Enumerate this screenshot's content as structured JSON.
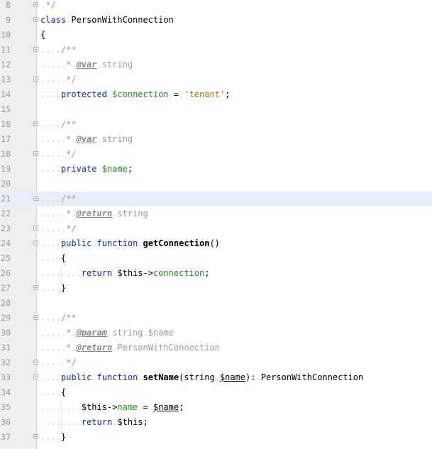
{
  "colors": {
    "keyword": "#0b2bb3",
    "variable": "#238a23",
    "string": "#b8711a",
    "comment": "#9a9a9a",
    "doc_tag": "#888888",
    "whitespace_marker": "#d0d0d0",
    "current_line_bg": "#e8eef8",
    "gutter_bg": "#efefef"
  },
  "editor": {
    "current_line": 21,
    "lines": [
      {
        "n": "8",
        "fold": true,
        "t": [
          [
            "ws",
            "."
          ],
          [
            "cmt",
            "*/"
          ]
        ]
      },
      {
        "n": "9",
        "fold": true,
        "t": [
          [
            "kw",
            "class"
          ],
          [
            "ws",
            "."
          ],
          [
            "pl",
            "PersonWithConnection"
          ]
        ]
      },
      {
        "n": "10",
        "fold": false,
        "t": [
          [
            "pl",
            "{"
          ]
        ]
      },
      {
        "n": "11",
        "fold": true,
        "t": [
          [
            "ws",
            "...."
          ],
          [
            "cmt",
            "/**"
          ]
        ]
      },
      {
        "n": "12",
        "fold": false,
        "t": [
          [
            "ws",
            "....."
          ],
          [
            "cmt",
            "*"
          ],
          [
            "ws",
            "."
          ],
          [
            "tag",
            "@var"
          ],
          [
            "ws",
            "."
          ],
          [
            "cmt",
            "string"
          ]
        ]
      },
      {
        "n": "13",
        "fold": true,
        "t": [
          [
            "ws",
            "....."
          ],
          [
            "cmt",
            "*/"
          ]
        ]
      },
      {
        "n": "14",
        "fold": false,
        "t": [
          [
            "ws",
            "...."
          ],
          [
            "kw",
            "protected"
          ],
          [
            "ws",
            "."
          ],
          [
            "var",
            "$connection"
          ],
          [
            "ws",
            "."
          ],
          [
            "pl",
            "="
          ],
          [
            "ws",
            "."
          ],
          [
            "str",
            "'tenant'"
          ],
          [
            "pl",
            ";"
          ]
        ]
      },
      {
        "n": "15",
        "fold": false,
        "t": []
      },
      {
        "n": "16",
        "fold": true,
        "t": [
          [
            "ws",
            "...."
          ],
          [
            "cmt",
            "/**"
          ]
        ]
      },
      {
        "n": "17",
        "fold": false,
        "t": [
          [
            "ws",
            "....."
          ],
          [
            "cmt",
            "*"
          ],
          [
            "ws",
            "."
          ],
          [
            "tag",
            "@var"
          ],
          [
            "ws",
            "."
          ],
          [
            "cmt",
            "string"
          ]
        ]
      },
      {
        "n": "18",
        "fold": true,
        "t": [
          [
            "ws",
            "....."
          ],
          [
            "cmt",
            "*/"
          ]
        ]
      },
      {
        "n": "19",
        "fold": false,
        "t": [
          [
            "ws",
            "...."
          ],
          [
            "kw",
            "private"
          ],
          [
            "ws",
            "."
          ],
          [
            "var",
            "$name"
          ],
          [
            "pl",
            ";"
          ]
        ]
      },
      {
        "n": "20",
        "fold": false,
        "t": []
      },
      {
        "n": "21",
        "fold": true,
        "t": [
          [
            "ws",
            "...."
          ],
          [
            "cmt",
            "/**"
          ]
        ]
      },
      {
        "n": "22",
        "fold": false,
        "t": [
          [
            "ws",
            "....."
          ],
          [
            "cmt",
            "*"
          ],
          [
            "ws",
            "."
          ],
          [
            "tag",
            "@return"
          ],
          [
            "ws",
            "."
          ],
          [
            "cmt",
            "string"
          ]
        ]
      },
      {
        "n": "23",
        "fold": true,
        "t": [
          [
            "ws",
            "....."
          ],
          [
            "cmt",
            "*/"
          ]
        ]
      },
      {
        "n": "24",
        "fold": true,
        "t": [
          [
            "ws",
            "...."
          ],
          [
            "kw",
            "public"
          ],
          [
            "ws",
            "."
          ],
          [
            "kw",
            "function"
          ],
          [
            "ws",
            "."
          ],
          [
            "fn",
            "getConnection"
          ],
          [
            "pl",
            "()"
          ]
        ]
      },
      {
        "n": "25",
        "fold": false,
        "t": [
          [
            "ws",
            "...."
          ],
          [
            "pl",
            "{"
          ]
        ]
      },
      {
        "n": "26",
        "fold": false,
        "t": [
          [
            "ws",
            "........"
          ],
          [
            "kw",
            "return"
          ],
          [
            "ws",
            "."
          ],
          [
            "pl",
            "$this->"
          ],
          [
            "var",
            "connection"
          ],
          [
            "pl",
            ";"
          ]
        ]
      },
      {
        "n": "27",
        "fold": true,
        "t": [
          [
            "ws",
            "...."
          ],
          [
            "pl",
            "}"
          ]
        ]
      },
      {
        "n": "28",
        "fold": false,
        "t": []
      },
      {
        "n": "29",
        "fold": true,
        "t": [
          [
            "ws",
            "...."
          ],
          [
            "cmt",
            "/**"
          ]
        ]
      },
      {
        "n": "30",
        "fold": false,
        "t": [
          [
            "ws",
            "....."
          ],
          [
            "cmt",
            "*"
          ],
          [
            "ws",
            "."
          ],
          [
            "tag",
            "@param"
          ],
          [
            "ws",
            "."
          ],
          [
            "cmt",
            "string"
          ],
          [
            "ws",
            "."
          ],
          [
            "cmt",
            "$name"
          ]
        ]
      },
      {
        "n": "31",
        "fold": false,
        "t": [
          [
            "ws",
            "....."
          ],
          [
            "cmt",
            "*"
          ],
          [
            "ws",
            "."
          ],
          [
            "tag",
            "@return"
          ],
          [
            "ws",
            "."
          ],
          [
            "cmt",
            "PersonWithConnection"
          ]
        ]
      },
      {
        "n": "32",
        "fold": true,
        "t": [
          [
            "ws",
            "....."
          ],
          [
            "cmt",
            "*/"
          ]
        ]
      },
      {
        "n": "33",
        "fold": true,
        "t": [
          [
            "ws",
            "...."
          ],
          [
            "kw",
            "public"
          ],
          [
            "ws",
            "."
          ],
          [
            "kw",
            "function"
          ],
          [
            "ws",
            "."
          ],
          [
            "fn",
            "setName"
          ],
          [
            "pl",
            "(string"
          ],
          [
            "ws",
            "."
          ],
          [
            "par",
            "$name"
          ],
          [
            "pl",
            "):"
          ],
          [
            "ws",
            "."
          ],
          [
            "pl",
            "PersonWithConnection"
          ]
        ]
      },
      {
        "n": "34",
        "fold": false,
        "t": [
          [
            "ws",
            "...."
          ],
          [
            "pl",
            "{"
          ]
        ]
      },
      {
        "n": "35",
        "fold": false,
        "t": [
          [
            "ws",
            "........"
          ],
          [
            "pl",
            "$this->"
          ],
          [
            "var",
            "name"
          ],
          [
            "ws",
            "."
          ],
          [
            "pl",
            "="
          ],
          [
            "ws",
            "."
          ],
          [
            "par",
            "$name"
          ],
          [
            "pl",
            ";"
          ]
        ]
      },
      {
        "n": "36",
        "fold": false,
        "t": [
          [
            "ws",
            "........"
          ],
          [
            "kw",
            "return"
          ],
          [
            "ws",
            "."
          ],
          [
            "pl",
            "$this;"
          ]
        ]
      },
      {
        "n": "37",
        "fold": true,
        "t": [
          [
            "ws",
            "...."
          ],
          [
            "pl",
            "}"
          ]
        ]
      }
    ]
  }
}
